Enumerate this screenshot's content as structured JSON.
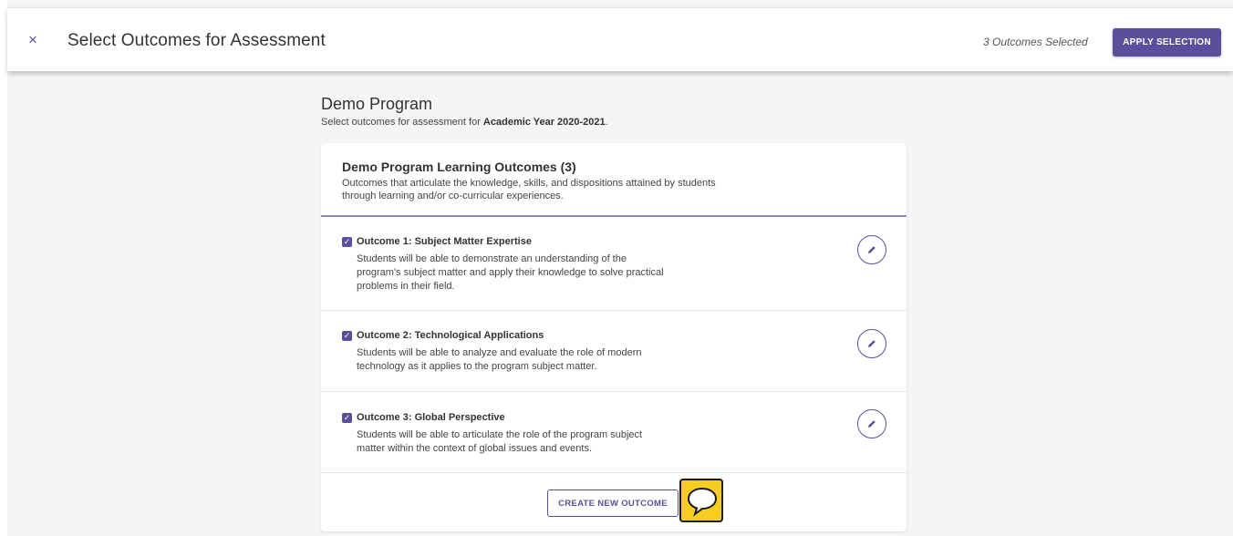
{
  "header": {
    "close_icon": "×",
    "title": "Select Outcomes for Assessment",
    "selected_count": "3 Outcomes Selected",
    "apply_label": "APPLY SELECTION"
  },
  "program": {
    "name": "Demo Program",
    "subtitle_prefix": "Select outcomes for assessment for ",
    "academic_year": "Academic Year 2020-2021",
    "subtitle_suffix": "."
  },
  "card": {
    "title": "Demo Program Learning Outcomes (3)",
    "description": "Outcomes that articulate the knowledge, skills, and dispositions attained by students through learning and/or co-curricular experiences."
  },
  "outcomes": [
    {
      "checked": true,
      "name": "Outcome 1: Subject Matter Expertise",
      "description": "Students will be able to demonstrate an understanding of the program's subject matter and apply their knowledge to solve practical problems in their field.",
      "edit_icon": "pencil-icon"
    },
    {
      "checked": true,
      "name": "Outcome 2: Technological Applications",
      "description": "Students will be able to analyze and evaluate the role of modern technology as it applies to the program subject matter.",
      "edit_icon": "pencil-icon"
    },
    {
      "checked": true,
      "name": "Outcome 3: Global Perspective",
      "description": "Students will be able to articulate the role of the program subject matter within the context of global issues and events.",
      "edit_icon": "pencil-icon"
    }
  ],
  "create_label": "CREATE NEW OUTCOME",
  "chat_icon": "speech-bubble-icon",
  "colors": {
    "accent": "#5b4e9a",
    "background": "#f5f5f5",
    "chat_yellow": "#f7cd1f"
  }
}
